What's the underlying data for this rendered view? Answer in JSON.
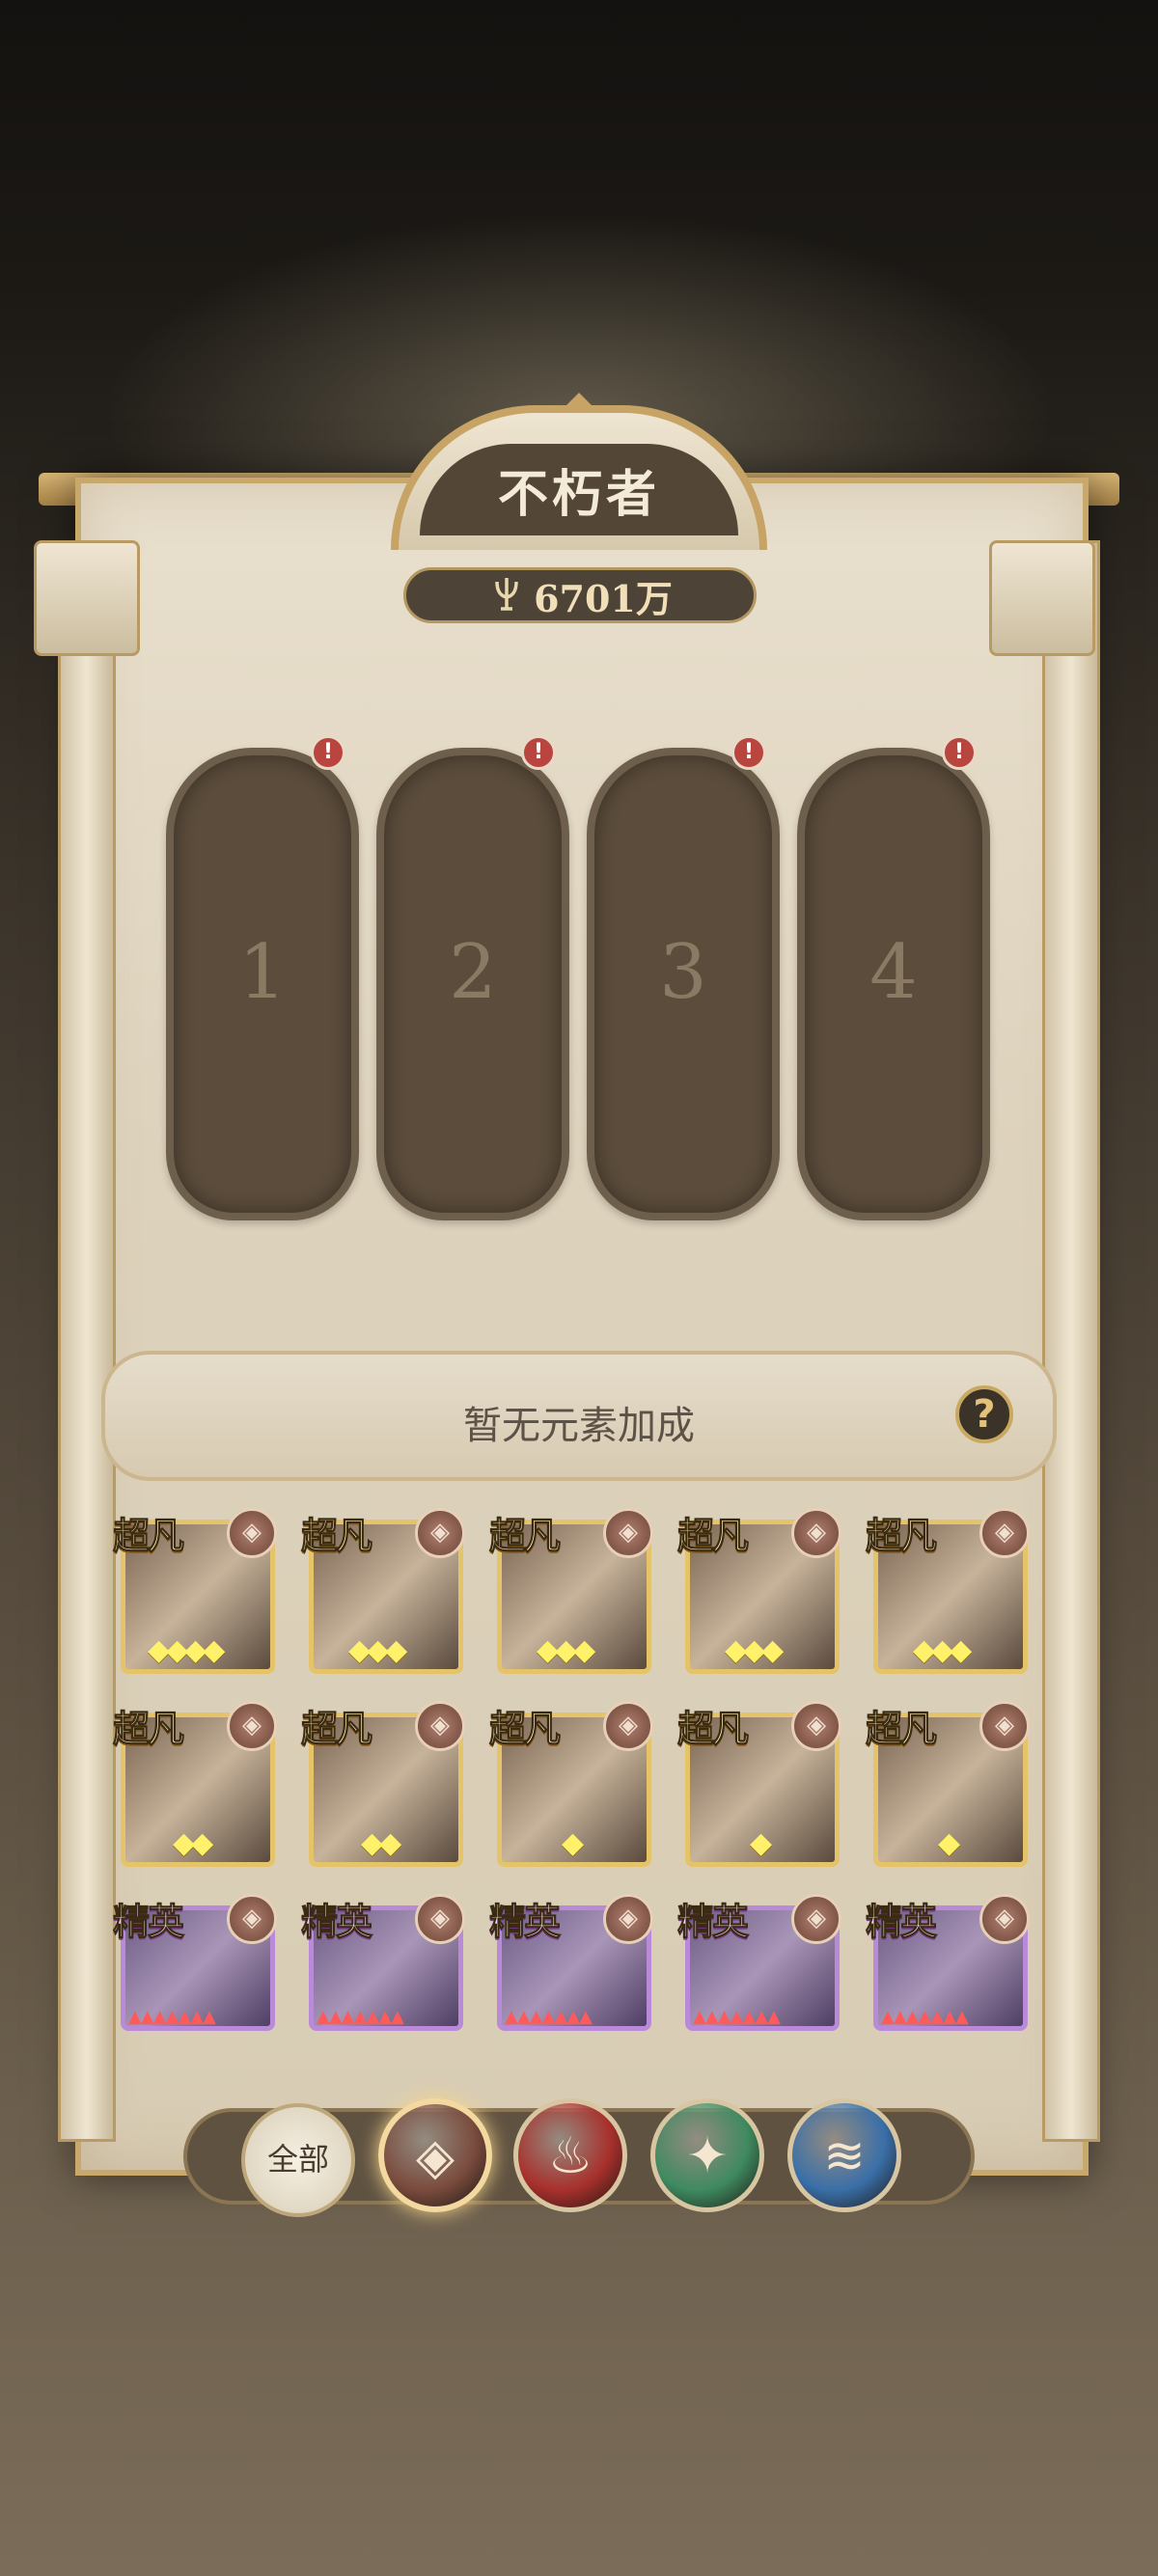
{
  "header": {
    "title": "不朽者",
    "power_value": "6701万",
    "power_icon": "trident-icon"
  },
  "slots": [
    {
      "label": "1",
      "alert": "!"
    },
    {
      "label": "2",
      "alert": "!"
    },
    {
      "label": "3",
      "alert": "!"
    },
    {
      "label": "4",
      "alert": "!"
    }
  ],
  "bonus": {
    "text": "暂无元素加成",
    "help": "?"
  },
  "heroes": [
    {
      "rank": "超凡",
      "tier": "gold",
      "stars": 4,
      "element": "earth"
    },
    {
      "rank": "超凡",
      "tier": "gold",
      "stars": 3,
      "element": "earth"
    },
    {
      "rank": "超凡",
      "tier": "gold",
      "stars": 3,
      "element": "earth"
    },
    {
      "rank": "超凡",
      "tier": "gold",
      "stars": 3,
      "element": "earth"
    },
    {
      "rank": "超凡",
      "tier": "gold",
      "stars": 3,
      "element": "earth"
    },
    {
      "rank": "超凡",
      "tier": "gold",
      "stars": 2,
      "element": "earth"
    },
    {
      "rank": "超凡",
      "tier": "gold",
      "stars": 2,
      "element": "earth"
    },
    {
      "rank": "超凡",
      "tier": "gold",
      "stars": 1,
      "element": "earth"
    },
    {
      "rank": "超凡",
      "tier": "gold",
      "stars": 1,
      "element": "earth"
    },
    {
      "rank": "超凡",
      "tier": "gold",
      "stars": 1,
      "element": "earth"
    },
    {
      "rank": "精英",
      "tier": "purple",
      "stars": 5,
      "element": "earth"
    },
    {
      "rank": "精英",
      "tier": "purple",
      "stars": 5,
      "element": "earth"
    },
    {
      "rank": "精英",
      "tier": "purple",
      "stars": 5,
      "element": "earth"
    },
    {
      "rank": "精英",
      "tier": "purple",
      "stars": 5,
      "element": "earth"
    },
    {
      "rank": "精英",
      "tier": "purple",
      "stars": 5,
      "element": "earth"
    }
  ],
  "filters": {
    "all_label": "全部",
    "elements": [
      {
        "name": "earth",
        "color": "#7a4c3e",
        "icon": "earth-icon",
        "glyph": "◈"
      },
      {
        "name": "fire",
        "color": "#a8302c",
        "icon": "flame-icon",
        "glyph": "♨"
      },
      {
        "name": "wind",
        "color": "#3f8a60",
        "icon": "wind-icon",
        "glyph": "✦"
      },
      {
        "name": "water",
        "color": "#3a6fa8",
        "icon": "water-icon",
        "glyph": "≋"
      }
    ]
  },
  "colors": {
    "gold_border": "#e5c369",
    "purple_border": "#b98ad8",
    "alert": "#b8453e"
  }
}
